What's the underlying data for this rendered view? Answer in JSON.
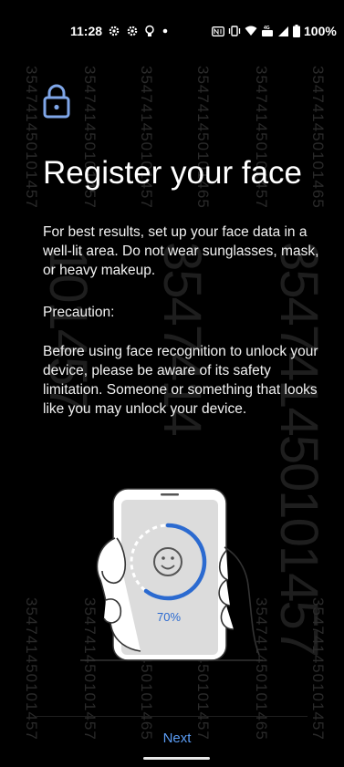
{
  "status_bar": {
    "time": "11:28",
    "battery": "100%",
    "icons_left": [
      "settings-icon",
      "settings-icon",
      "bulb-icon",
      "dot-icon"
    ],
    "icons_right": [
      "nfc-icon",
      "vibrate-icon",
      "wifi-icon",
      "volte-icon",
      "signal-icon",
      "battery-icon"
    ]
  },
  "watermark": {
    "number": "354741450101457",
    "col_a": "354741450101457",
    "col_b": "354741450101465",
    "big_a": "101457",
    "big_b": "3547414"
  },
  "header": {
    "icon": "lock-icon",
    "title": "Register your face"
  },
  "body": {
    "tip": "For best results, set up your face data in a well-lit area. Do not wear sunglasses, mask, or heavy makeup.",
    "precaution_heading": "Precaution:",
    "precaution_text": "Before using face recognition to unlock your device, please be aware of its safety limitation. Someone or something that looks like you may unlock your device."
  },
  "illustration": {
    "progress_label": "70%",
    "progress": 0.7
  },
  "footer": {
    "next_label": "Next"
  },
  "colors": {
    "background": "#000000",
    "accent": "#5b9df5",
    "progress_arc": "#2b6ad0",
    "lock_icon": "#7fa6e8"
  }
}
